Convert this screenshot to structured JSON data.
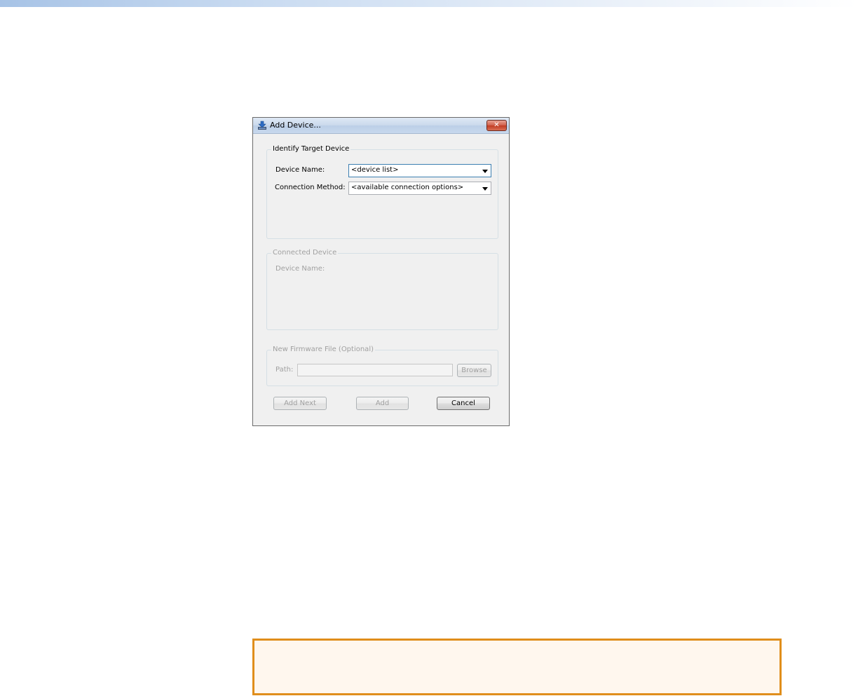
{
  "dialog": {
    "title": "Add Device...",
    "close_symbol": "✕",
    "identify_group": {
      "label": "Identify Target Device",
      "device_name_label": "Device Name:",
      "device_name_value": "<device list>",
      "connection_method_label": "Connection Method:",
      "connection_method_value": "<available connection options>"
    },
    "connected_group": {
      "label": "Connected Device",
      "device_name_label": "Device Name:"
    },
    "firmware_group": {
      "label": "New Firmware File (Optional)",
      "path_label": "Path:",
      "path_value": "",
      "browse_label": "Browse"
    },
    "buttons": {
      "add_next": "Add Next",
      "add": "Add",
      "cancel": "Cancel"
    }
  },
  "icons": {
    "title_icon": "device-download-icon",
    "close_icon": "close-icon",
    "dropdown_icon": "chevron-down-icon"
  },
  "colors": {
    "note_border": "#e08e1b",
    "note_fill": "#fff7ee",
    "close_button": "#c23c23"
  }
}
